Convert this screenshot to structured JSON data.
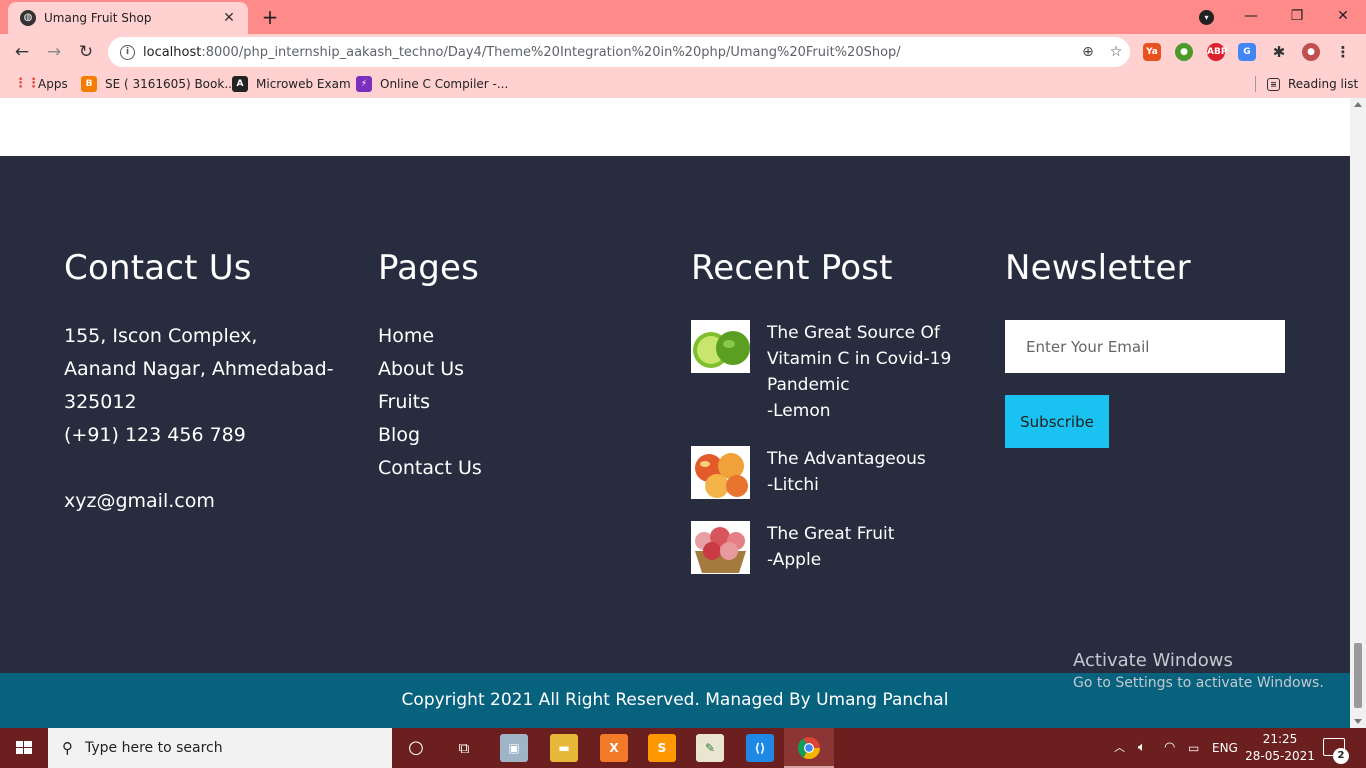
{
  "browser": {
    "tab_title": "Umang Fruit Shop",
    "url_host": "localhost",
    "url_rest": ":8000/php_internship_aakash_techno/Day4/Theme%20Integration%20in%20php/Umang%20Fruit%20Shop/",
    "bookmarks": [
      {
        "label": "Apps",
        "icon": "apps-grid-icon",
        "color": "#e8453c"
      },
      {
        "label": "SE ( 3161605) Book...",
        "icon": "blogger-icon",
        "color": "#f57d00"
      },
      {
        "label": "Microweb Exam",
        "icon": "angular-icon",
        "color": "#222222"
      },
      {
        "label": "Online C Compiler -...",
        "icon": "lightning-icon",
        "color": "#7b2fbf"
      }
    ],
    "reading_list": "Reading list"
  },
  "footer": {
    "contact": {
      "heading": "Contact Us",
      "address": "155, Iscon Complex, Aanand Nagar, Ahmedabad-325012",
      "phone": "(+91) 123 456 789",
      "email": "xyz@gmail.com"
    },
    "pages": {
      "heading": "Pages",
      "links": [
        "Home",
        "About Us",
        "Fruits",
        "Blog",
        "Contact Us"
      ]
    },
    "recent": {
      "heading": "Recent Post",
      "posts": [
        {
          "title": "The Great Source Of Vitamin C in Covid-19 Pandemic",
          "fruit": "-Lemon"
        },
        {
          "title": "The Advantageous",
          "fruit": "-Litchi"
        },
        {
          "title": "The Great Fruit",
          "fruit": "-Apple"
        }
      ]
    },
    "newsletter": {
      "heading": "Newsletter",
      "placeholder": "Enter Your Email",
      "button": "Subscribe"
    },
    "copyright": "Copyright 2021 All Right Reserved. Managed By Umang Panchal"
  },
  "watermark": {
    "line1": "Activate Windows",
    "line2": "Go to Settings to activate Windows."
  },
  "taskbar": {
    "search_placeholder": "Type here to search",
    "language": "ENG",
    "time": "21:25",
    "date": "28-05-2021",
    "notifications": "2"
  },
  "colors": {
    "footer_bg": "#282c3f",
    "copyright_bg": "#07627e",
    "subscribe_bg": "#19c2f0",
    "tab_strip": "#ff8a8a",
    "toolbar": "#ffd1d1"
  }
}
